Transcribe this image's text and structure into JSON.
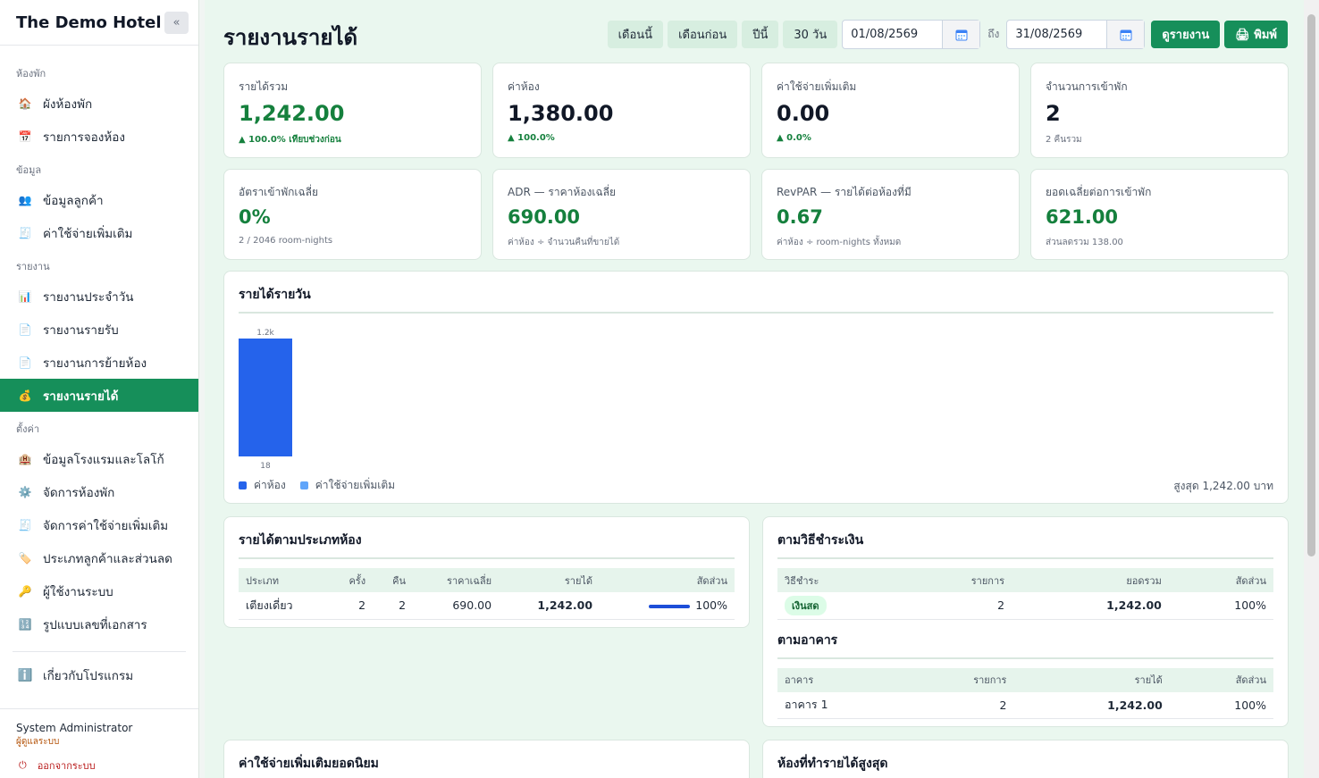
{
  "sidebar": {
    "brand": "The Demo Hotel",
    "collapse_label": "«",
    "sections": [
      {
        "label": "ห้องพัก",
        "items": [
          {
            "label": "ผังห้องพัก",
            "icon": "🏠"
          },
          {
            "label": "รายการจองห้อง",
            "icon": "📅"
          }
        ]
      },
      {
        "label": "ข้อมูล",
        "items": [
          {
            "label": "ข้อมูลลูกค้า",
            "icon": "👥"
          },
          {
            "label": "ค่าใช้จ่ายเพิ่มเติม",
            "icon": "🧾"
          }
        ]
      },
      {
        "label": "รายงาน",
        "items": [
          {
            "label": "รายงานประจำวัน",
            "icon": "📊"
          },
          {
            "label": "รายงานรายรับ",
            "icon": "📄"
          },
          {
            "label": "รายงานการย้ายห้อง",
            "icon": "📄"
          },
          {
            "label": "รายงานรายได้",
            "icon": "💰"
          }
        ]
      },
      {
        "label": "ตั้งค่า",
        "items": [
          {
            "label": "ข้อมูลโรงแรมและโลโก้",
            "icon": "🏨"
          },
          {
            "label": "จัดการห้องพัก",
            "icon": "⚙️"
          },
          {
            "label": "จัดการค่าใช้จ่ายเพิ่มเติม",
            "icon": "🧾"
          },
          {
            "label": "ประเภทลูกค้าและส่วนลด",
            "icon": "🏷️"
          },
          {
            "label": "ผู้ใช้งานระบบ",
            "icon": "🔑"
          },
          {
            "label": "รูปแบบเลขที่เอกสาร",
            "icon": "🔢"
          }
        ]
      }
    ],
    "about": {
      "label": "เกี่ยวกับโปรแกรม",
      "icon": "ℹ️"
    },
    "user": {
      "name": "System Administrator",
      "role": "ผู้ดูแลระบบ",
      "logout": "ออกจากระบบ"
    },
    "active_item": "รายงานรายได้"
  },
  "header": {
    "title": "รายงานรายได้",
    "quick_ranges": [
      "เดือนนี้",
      "เดือนก่อน",
      "ปีนี้",
      "30 วัน"
    ],
    "date_from": "01/08/2569",
    "to_label": "ถึง",
    "date_to": "31/08/2569",
    "view_button": "ดูรายงาน",
    "print_button": "🖨 พิมพ์"
  },
  "kpis": [
    {
      "label": "รายได้รวม",
      "value": "1,242.00",
      "sub": "▲ 100.0% เทียบช่วงก่อน"
    },
    {
      "label": "ค่าห้อง",
      "value": "1,380.00",
      "sub": "▲ 100.0%"
    },
    {
      "label": "ค่าใช้จ่ายเพิ่มเติม",
      "value": "0.00",
      "sub": "▲ 0.0%"
    },
    {
      "label": "จำนวนการเข้าพัก",
      "value": "2",
      "sub": "2 คืนรวม"
    }
  ],
  "kpis2": [
    {
      "label": "อัตราเข้าพักเฉลี่ย",
      "value": "0%",
      "sub": "2 / 2046 room-nights"
    },
    {
      "label": "ADR — ราคาห้องเฉลี่ย",
      "value": "690.00",
      "sub": "ค่าห้อง ÷ จำนวนคืนที่ขายได้"
    },
    {
      "label": "RevPAR — รายได้ต่อห้องที่มี",
      "value": "0.67",
      "sub": "ค่าห้อง ÷ room-nights ทั้งหมด"
    },
    {
      "label": "ยอดเฉลี่ยต่อการเข้าพัก",
      "value": "621.00",
      "sub": "ส่วนลดรวม 138.00"
    }
  ],
  "daily": {
    "title": "รายได้รายวัน",
    "legend": [
      {
        "label": "ค่าห้อง",
        "color": "#2563eb"
      },
      {
        "label": "ค่าใช้จ่ายเพิ่มเติม",
        "color": "#60a5fa"
      }
    ],
    "max_note": "สูงสุด 1,242.00 บาท"
  },
  "chart_data": {
    "type": "bar",
    "title": "รายได้รายวัน",
    "categories": [
      "18"
    ],
    "series": [
      {
        "name": "ค่าห้อง",
        "values": [
          1242
        ]
      },
      {
        "name": "ค่าใช้จ่ายเพิ่มเติม",
        "values": [
          0
        ]
      }
    ],
    "data_labels": [
      "1.2k"
    ],
    "ylim": [
      0,
      1242
    ],
    "legend": "bottom-left"
  },
  "room_type": {
    "title": "รายได้ตามประเภทห้อง",
    "headers": [
      "ประเภท",
      "ครั้ง",
      "คืน",
      "ราคาเฉลี่ย",
      "รายได้",
      "สัดส่วน"
    ],
    "rows": [
      {
        "type": "เตียงเดี่ยว",
        "count": "2",
        "nights": "2",
        "avg": "690.00",
        "revenue": "1,242.00",
        "share": "100%",
        "share_value": 1.0
      }
    ]
  },
  "payment": {
    "title": "ตามวิธีชำระเงิน",
    "headers": [
      "วิธีชำระ",
      "รายการ",
      "ยอดรวม",
      "สัดส่วน"
    ],
    "rows": [
      {
        "method": "เงินสด",
        "count": "2",
        "total": "1,242.00",
        "share": "100%"
      }
    ]
  },
  "building": {
    "title": "ตามอาคาร",
    "headers": [
      "อาคาร",
      "รายการ",
      "รายได้",
      "สัดส่วน"
    ],
    "rows": [
      {
        "name": "อาคาร 1",
        "count": "2",
        "revenue": "1,242.00",
        "share": "100%"
      }
    ]
  },
  "popular_extras": {
    "title": "ค่าใช้จ่ายเพิ่มเติมยอดนิยม"
  },
  "top_rooms": {
    "title": "ห้องที่ทำรายได้สูงสุด"
  }
}
